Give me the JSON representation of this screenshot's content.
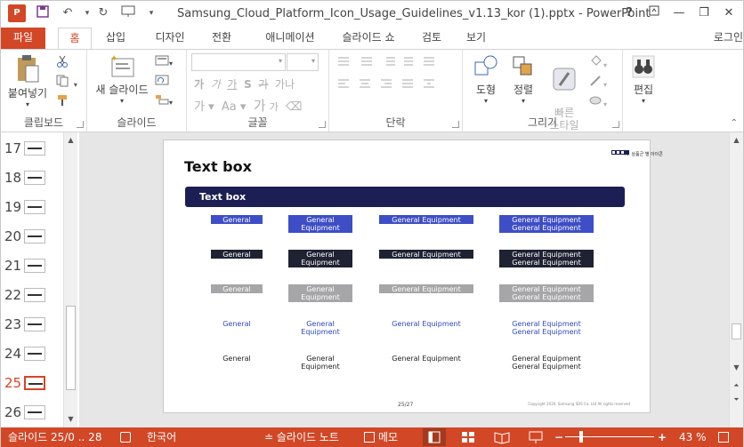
{
  "app": {
    "icon_label": "P",
    "title": "Samsung_Cloud_Platform_Icon_Usage_Guidelines_v1.13_kor (1).pptx - PowerPoint",
    "help": "?",
    "signin": "로그인"
  },
  "tabs": [
    {
      "label": "파일"
    },
    {
      "label": "홈"
    },
    {
      "label": "삽입"
    },
    {
      "label": "디자인"
    },
    {
      "label": "전환"
    },
    {
      "label": "애니메이션"
    },
    {
      "label": "슬라이드 쇼"
    },
    {
      "label": "검토"
    },
    {
      "label": "보기"
    }
  ],
  "ribbon": {
    "clipboard": {
      "paste": "붙여넣기",
      "label": "클립보드"
    },
    "slides": {
      "new_slide": "새 슬라이드",
      "label": "슬라이드"
    },
    "font": {
      "label": "글꼴",
      "shadow": "S",
      "spacing": "가나",
      "case": "Aa",
      "grow": "가",
      "shrink": "가",
      "bold": "가",
      "italic": "가",
      "underline": "가",
      "strike": "가"
    },
    "paragraph": {
      "label": "단락"
    },
    "drawing": {
      "shape": "도형",
      "arrange": "정렬",
      "quick_styles": "빠른\n스타일",
      "label": "그리기"
    },
    "editing": {
      "label": "편집"
    }
  },
  "thumbnails": [
    {
      "num": "17"
    },
    {
      "num": "18"
    },
    {
      "num": "19"
    },
    {
      "num": "20"
    },
    {
      "num": "21"
    },
    {
      "num": "22"
    },
    {
      "num": "23"
    },
    {
      "num": "24"
    },
    {
      "num": "25"
    },
    {
      "num": "26"
    }
  ],
  "slide": {
    "title": "Text box",
    "section": "IV. 상품군 별 아이콘",
    "banner": "Text box",
    "page": "25/27",
    "copyright": "Copyright 2020. Samsung SDS Co. Ltd All rights reserved",
    "rows": [
      {
        "style": "blue-fill",
        "items": [
          "General",
          "General\nEquipment",
          "General Equipment",
          "General Equipment\nGeneral Equipment"
        ]
      },
      {
        "style": "dark-fill",
        "items": [
          "General",
          "General\nEquipment",
          "General Equipment",
          "General Equipment\nGeneral Equipment"
        ]
      },
      {
        "style": "gray-fill",
        "items": [
          "General",
          "General\nEquipment",
          "General Equipment",
          "General Equipment\nGeneral Equipment"
        ]
      },
      {
        "style": "blue-text",
        "items": [
          "General",
          "General\nEquipment",
          "General Equipment",
          "General Equipment\nGeneral Equipment"
        ]
      },
      {
        "style": "black-text",
        "items": [
          "General",
          "General\nEquipment",
          "General Equipment",
          "General Equipment\nGeneral Equipment"
        ]
      }
    ]
  },
  "status": {
    "slide_info": "슬라이드 25/0 .. 28",
    "language": "한국어",
    "notes": "슬라이드 노트",
    "comments": "메모",
    "zoom": "43 %",
    "zoom_level": 0.43
  },
  "colors": {
    "accent": "#d24726",
    "navy": "#1b1f53",
    "blue": "#3d4ec7",
    "dark": "#1e2232",
    "gray": "#a6a6a8",
    "blue_text": "#2f47c0"
  }
}
